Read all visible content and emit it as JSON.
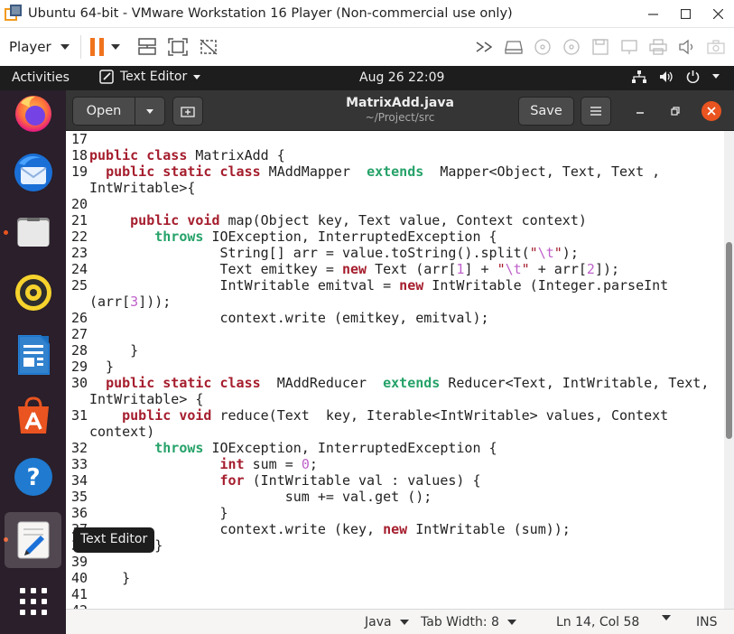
{
  "vmware": {
    "title": "Ubuntu 64-bit - VMware Workstation 16 Player (Non-commercial use only)",
    "player_menu": "Player"
  },
  "gnome": {
    "activities": "Activities",
    "app_menu": "Text Editor",
    "clock": "Aug 26  22:09"
  },
  "dock": {
    "tooltip": "Text Editor",
    "apps": [
      "firefox-icon",
      "thunderbird-icon",
      "files-icon",
      "rhythmbox-icon",
      "libreoffice-writer-icon",
      "software-center-icon",
      "help-icon",
      "text-editor-icon",
      "show-apps-icon"
    ]
  },
  "gedit": {
    "open_label": "Open",
    "save_label": "Save",
    "filename": "MatrixAdd.java",
    "path": "~/Project/src"
  },
  "code_lines": [
    {
      "n": "17",
      "text": ""
    },
    {
      "n": "18",
      "text": "public class MatrixAdd {"
    },
    {
      "n": "19",
      "text": "  public static class MAddMapper  extends  Mapper<Object, Text, Text ,"
    },
    {
      "n": "",
      "text": "IntWritable>{"
    },
    {
      "n": "20",
      "text": ""
    },
    {
      "n": "21",
      "text": "     public void map(Object key, Text value, Context context)"
    },
    {
      "n": "22",
      "text": "        throws IOException, InterruptedException {"
    },
    {
      "n": "23",
      "text": "                String[] arr = value.toString().split(\"\\t\");"
    },
    {
      "n": "24",
      "text": "                Text emitkey = new Text (arr[1] + \"\\t\" + arr[2]);"
    },
    {
      "n": "25",
      "text": "                IntWritable emitval = new IntWritable (Integer.parseInt"
    },
    {
      "n": "",
      "text": "(arr[3]));"
    },
    {
      "n": "26",
      "text": "                context.write (emitkey, emitval);"
    },
    {
      "n": "27",
      "text": ""
    },
    {
      "n": "28",
      "text": "     }"
    },
    {
      "n": "29",
      "text": "  }"
    },
    {
      "n": "30",
      "text": "  public static class  MAddReducer  extends Reducer<Text, IntWritable, Text,"
    },
    {
      "n": "",
      "text": "IntWritable> {"
    },
    {
      "n": "31",
      "text": "    public void reduce(Text  key, Iterable<IntWritable> values, Context"
    },
    {
      "n": "",
      "text": "context)"
    },
    {
      "n": "32",
      "text": "        throws IOException, InterruptedException {"
    },
    {
      "n": "33",
      "text": "                int sum = 0;"
    },
    {
      "n": "34",
      "text": "                for (IntWritable val : values) {"
    },
    {
      "n": "35",
      "text": "                        sum += val.get ();"
    },
    {
      "n": "36",
      "text": "                }"
    },
    {
      "n": "37",
      "text": "                context.write (key, new IntWritable (sum));"
    },
    {
      "n": "38",
      "text": "        }"
    },
    {
      "n": "39",
      "text": ""
    },
    {
      "n": "40",
      "text": "    }"
    },
    {
      "n": "41",
      "text": ""
    },
    {
      "n": "42",
      "text": ""
    }
  ],
  "statusbar": {
    "language": "Java",
    "tab_width": "Tab Width: 8",
    "position": "Ln 14, Col 58",
    "mode": "INS"
  },
  "colors": {
    "accent": "#e95420",
    "keyword": "#a51d2d",
    "type": "#26a269",
    "escape": "#c061cb"
  }
}
